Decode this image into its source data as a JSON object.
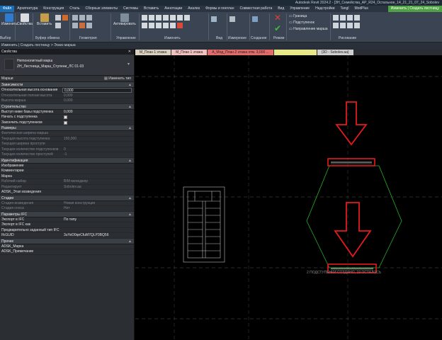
{
  "title_bar": {
    "title": "Autodesk Revit 2024.2 - [ЗН_Семейства_АР_R24_Остальное_14_21_21_07_24_Sobolev"
  },
  "menu": {
    "tabs": [
      {
        "label": "Файл",
        "style": "file"
      },
      {
        "label": "Архитектура"
      },
      {
        "label": "Конструкция"
      },
      {
        "label": "Сталь"
      },
      {
        "label": "Сборные элементы"
      },
      {
        "label": "Системы"
      },
      {
        "label": "Вставить"
      },
      {
        "label": "Аннотации"
      },
      {
        "label": "Анализ"
      },
      {
        "label": "Формы и генплан"
      },
      {
        "label": "Совместная работа"
      },
      {
        "label": "Вид"
      },
      {
        "label": "Управление"
      },
      {
        "label": "Надстройки"
      },
      {
        "label": "Tangl"
      },
      {
        "label": "ModPlus"
      },
      {
        "label": "Изменить | Создать лестницу",
        "style": "context"
      }
    ]
  },
  "ribbon": {
    "modify_label": "Изменить",
    "select_label": "Выбор",
    "props_label": "Свойства",
    "paste_label": "Вставить",
    "clipboard_label": "Буфер обмена",
    "geometry_label": "Геометрия",
    "activate_label": "Активировать",
    "manage_label": "Управление",
    "modify2_label": "Изменить",
    "view_label": "Вид",
    "measure_label": "Измерение",
    "create_label": "Создание",
    "mode_label": "Режим",
    "boundary_label": "Граница",
    "riser_label": "Подступенок",
    "path_label": "Направление марша",
    "draw_label": "Рисование"
  },
  "breadcrumb": "Изменить | Создать лестницу > Эскиз марша",
  "properties": {
    "header": "Свойства",
    "type_line1": "Неmонолитный марш",
    "type_line2": "ZН_Лестница_Марш_Ступени_ЛС 01-03",
    "selector": "Марши",
    "edit_type": "Изменить тип",
    "sections": [
      {
        "name": "Зависимости",
        "rows": [
          {
            "name": "Относительная высота основания",
            "value": "0,000",
            "box": true
          },
          {
            "name": "Относительная полная высота",
            "value": "0,000",
            "disabled": true
          },
          {
            "name": "Высота марша",
            "value": "0,000",
            "disabled": true
          }
        ]
      },
      {
        "name": "Строительство",
        "rows": [
          {
            "name": "Выступ ниже базы подступенка",
            "value": "0,000"
          },
          {
            "name": "Начать с подступенка",
            "value": "",
            "check": true
          },
          {
            "name": "Закончить подступенком",
            "value": "",
            "check": true
          }
        ]
      },
      {
        "name": "Размеры",
        "rows": [
          {
            "name": "Фактическая ширина марша",
            "value": "",
            "disabled": true
          },
          {
            "name": "Текущая высота подступенка",
            "value": "150,000",
            "disabled": true
          },
          {
            "name": "Текущая ширина проступи",
            "value": "",
            "disabled": true
          },
          {
            "name": "Текущее количество подступенков",
            "value": "0",
            "disabled": true
          },
          {
            "name": "Текущее количество проступей",
            "value": "-1",
            "disabled": true
          }
        ]
      },
      {
        "name": "Идентификация",
        "rows": [
          {
            "name": "Изображение",
            "value": ""
          },
          {
            "name": "Комментарии",
            "value": ""
          },
          {
            "name": "Марка",
            "value": ""
          },
          {
            "name": "Рабочий набор",
            "value": "BIM-менеджер",
            "disabled": true
          },
          {
            "name": "Редактирует",
            "value": "Sobolev.aa",
            "disabled": true
          },
          {
            "name": "ADSK_Этап возведения",
            "value": ""
          }
        ]
      },
      {
        "name": "Стадии",
        "rows": [
          {
            "name": "Стадия возведения",
            "value": "Новая конструкция",
            "disabled": true
          },
          {
            "name": "Стадия сноса",
            "value": "Нет",
            "disabled": true
          }
        ]
      },
      {
        "name": "Параметры IFC",
        "rows": [
          {
            "name": "Экспорт в IFC",
            "value": "По типу"
          },
          {
            "name": "Экспорт в IFC как",
            "value": ""
          },
          {
            "name": "Предварительно заданный тип IFC",
            "value": ""
          },
          {
            "name": "IfcGUID",
            "value": "3uYeD0qeCfuM7QLP3BQ56"
          }
        ]
      },
      {
        "name": "Прочее",
        "rows": [
          {
            "name": "ADSK_Марка",
            "value": ""
          },
          {
            "name": "ADSK_Примечание",
            "value": ""
          }
        ]
      }
    ]
  },
  "view_tabs": [
    {
      "label": "М_План 1 этажа",
      "color": "#d9d0c1"
    },
    {
      "label": "М_План 1 этажа",
      "color": "#f0c1bf"
    },
    {
      "label": "А_Мод_План 2 этажа отм. 3,000 ...",
      "color": "#e26c6c"
    },
    {
      "label": "",
      "color": "#e7e889"
    },
    {
      "label": "{3D - Sobolev.aa}",
      "color": "#cfcfcf"
    }
  ],
  "canvas": {
    "status_text": "2 ПОДСТУПЕНКИ СОЗДАНО, 19 ОСТАЛОСЬ",
    "arrow_color": "#e31b1b",
    "sketch_color": "#22b322"
  }
}
